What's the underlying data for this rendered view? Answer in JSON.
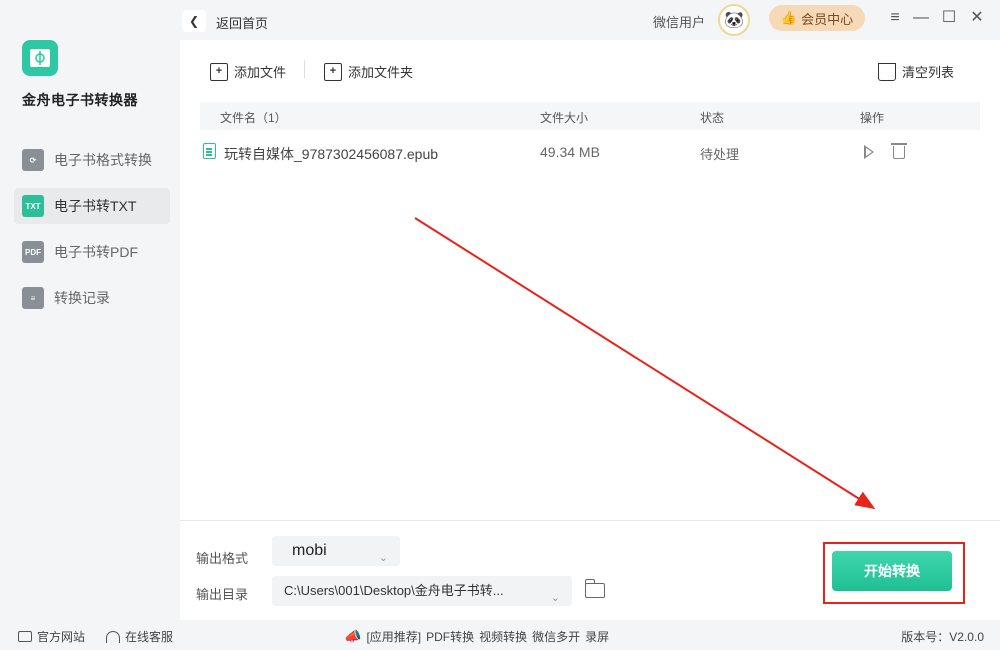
{
  "app": {
    "title": "金舟电子书转换器"
  },
  "sidebar": {
    "items": [
      {
        "label": "电子书格式转换",
        "icon": "convert-icon",
        "badge": ""
      },
      {
        "label": "电子书转TXT",
        "icon": "txt-icon",
        "badge": "TXT",
        "active": true
      },
      {
        "label": "电子书转PDF",
        "icon": "pdf-icon",
        "badge": "PDF"
      },
      {
        "label": "转换记录",
        "icon": "history-icon",
        "badge": ""
      }
    ]
  },
  "header": {
    "back_label": "返回首页",
    "username": "微信用户",
    "vip_label": "会员中心"
  },
  "toolbar": {
    "add_file": "添加文件",
    "add_folder": "添加文件夹",
    "clear_list": "清空列表"
  },
  "table": {
    "columns": [
      "文件名（1）",
      "文件大小",
      "状态",
      "操作"
    ],
    "rows": [
      {
        "name": "玩转自媒体_9787302456087.epub",
        "size": "49.34 MB",
        "status": "待处理"
      }
    ]
  },
  "output": {
    "format_label": "输出格式",
    "format_value": "mobi",
    "dir_label": "输出目录",
    "dir_value": "C:\\Users\\001\\Desktop\\金舟电子书转...",
    "start_label": "开始转换"
  },
  "statusbar": {
    "website": "官方网站",
    "service": "在线客服",
    "recommend": "[应用推荐]",
    "links": [
      "PDF转换",
      "视频转换",
      "微信多开",
      "录屏"
    ],
    "version": "版本号：V2.0.0"
  },
  "colors": {
    "accent": "#2cbf9a",
    "annotation": "#e8231b",
    "vip_bg": "#f6d9b7"
  }
}
